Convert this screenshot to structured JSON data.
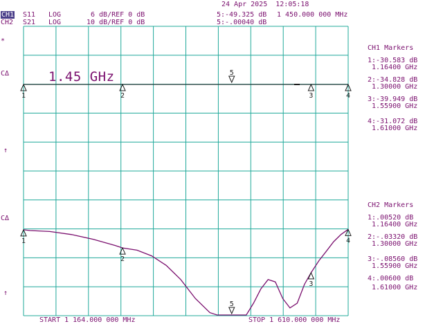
{
  "header": {
    "date_time": "24 Apr 2025  12:05:18",
    "ch1_label": "CH1",
    "ch1_param": "S11",
    "ch1_format": "LOG",
    "ch1_scale": "6 dB/REF 0 dB",
    "ch2_label": "CH2",
    "ch2_param": "S21",
    "ch2_format": "LOG",
    "ch2_scale": "10 dB/REF 0 dB",
    "marker5_ch1": "5:-49.325 dB",
    "marker5_freq": "1 450.000 000 MHz",
    "marker5_ch2": "5:-.00040 dB"
  },
  "symbols": {
    "star": "*",
    "c_delta_1": "CΔ",
    "c_delta_2": "CΔ",
    "arrow_up_1": "↑",
    "arrow_up_2": "↑"
  },
  "cursor_freq": "1.45 GHz",
  "ch1_markers": {
    "title": "CH1 Markers",
    "items": [
      {
        "label": "1:-30.583 dB",
        "freq": "1.16400 GHz"
      },
      {
        "label": "2:-34.828 dB",
        "freq": "1.30000 GHz"
      },
      {
        "label": "3:-39.949 dB",
        "freq": "1.55900 GHz"
      },
      {
        "label": "4:-31.072 dB",
        "freq": "1.61000 GHz"
      }
    ]
  },
  "ch2_markers": {
    "title": "CH2 Markers",
    "items": [
      {
        "label": "1:.00520 dB",
        "freq": "1.16400 GHz"
      },
      {
        "label": "2:-.03320 dB",
        "freq": "1.30000 GHz"
      },
      {
        "label": "3:-.08560 dB",
        "freq": "1.55900 GHz"
      },
      {
        "label": "4:.00600 dB",
        "freq": "1.61000 GHz"
      }
    ]
  },
  "footer": {
    "start": "START 1 164.000 000 MHz",
    "stop": "STOP 1 610.000 000 MHz"
  },
  "marker_numbers": [
    "1",
    "2",
    "3",
    "4",
    "5"
  ],
  "colors": {
    "grid": "#1fa89a",
    "trace": "#7a0f6e",
    "text": "#7a0f6e",
    "dark": "#1c1c1c"
  },
  "chart_data": {
    "type": "line",
    "x_start_mhz": 1164,
    "x_stop_mhz": 1610,
    "series": [
      {
        "name": "S21",
        "x": [
          1164,
          1173,
          1200,
          1230,
          1260,
          1290,
          1300,
          1320,
          1340,
          1360,
          1380,
          1400,
          1420,
          1430,
          1440,
          1450,
          1460,
          1470,
          1480,
          1490,
          1500,
          1510,
          1520,
          1530,
          1540,
          1550,
          1559,
          1570,
          1580,
          1590,
          1600,
          1610
        ],
        "y": [
          0.0052,
          0.0035,
          0.0015,
          -0.005,
          -0.015,
          -0.028,
          -0.0332,
          -0.038,
          -0.05,
          -0.07,
          -0.1,
          -0.14,
          -0.17,
          -0.175,
          -0.175,
          -0.175,
          -0.175,
          -0.175,
          -0.15,
          -0.12,
          -0.1,
          -0.105,
          -0.14,
          -0.16,
          -0.15,
          -0.11,
          -0.0856,
          -0.06,
          -0.04,
          -0.02,
          -0.005,
          0.006
        ]
      }
    ],
    "markers": [
      {
        "n": "1",
        "x": 1164
      },
      {
        "n": "2",
        "x": 1300
      },
      {
        "n": "3",
        "x": 1559
      },
      {
        "n": "4",
        "x": 1610
      },
      {
        "n": "5",
        "x": 1450
      }
    ]
  }
}
